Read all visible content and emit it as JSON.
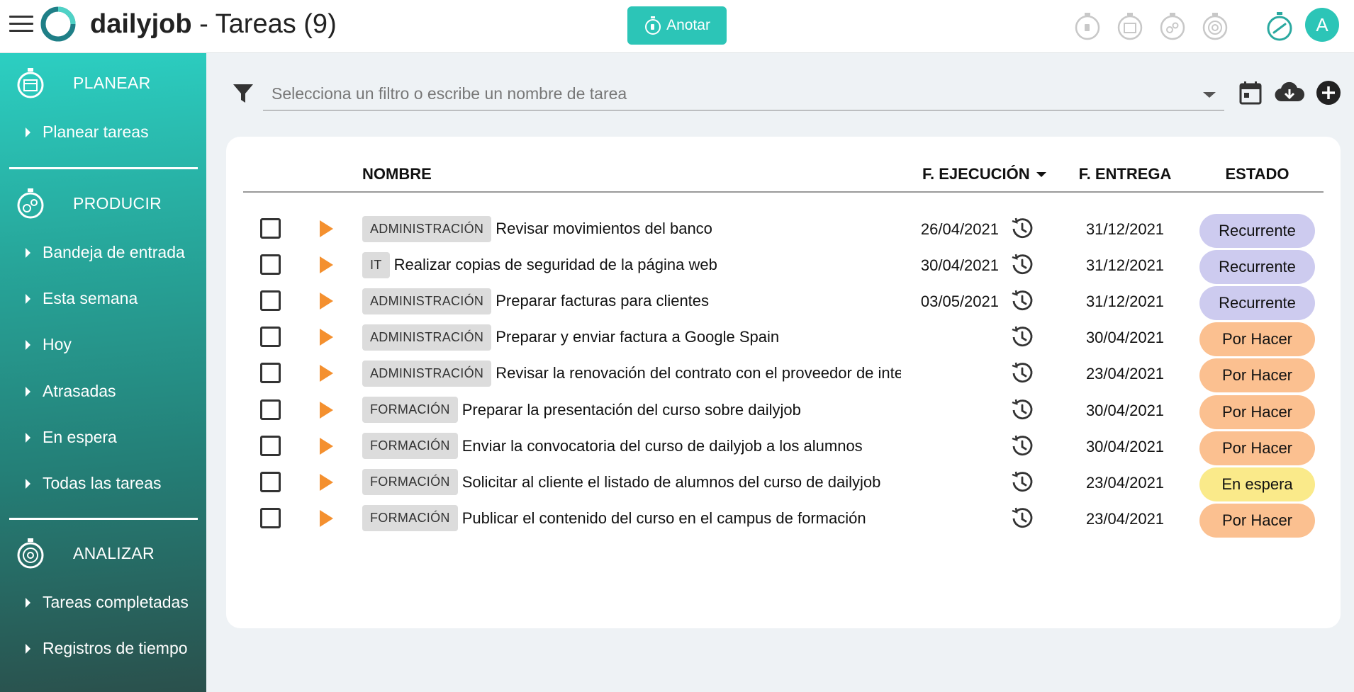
{
  "header": {
    "brand": "dailyjob",
    "page_title": " - Tareas (9)",
    "anotar_label": "Anotar",
    "avatar_initial": "A",
    "accent_color": "#2cc5b7"
  },
  "sidebar": {
    "sections": [
      {
        "label": "PLANEAR",
        "icon": "calendar-stopwatch-icon",
        "items": [
          "Planear tareas"
        ]
      },
      {
        "label": "PRODUCIR",
        "icon": "gears-stopwatch-icon",
        "items": [
          "Bandeja de entrada",
          "Esta semana",
          "Hoy",
          "Atrasadas",
          "En espera",
          "Todas las tareas"
        ]
      },
      {
        "label": "ANALIZAR",
        "icon": "target-stopwatch-icon",
        "items": [
          "Tareas completadas",
          "Registros de tiempo"
        ]
      }
    ]
  },
  "filter": {
    "placeholder": "Selecciona un filtro o escribe un nombre de tarea"
  },
  "table": {
    "columns": {
      "nombre": "NOMBRE",
      "f_ejecucion": "F. EJECUCIÓN",
      "f_entrega": "F. ENTREGA",
      "estado": "ESTADO"
    },
    "rows": [
      {
        "tag": "ADMINISTRACIÓN",
        "name": "Revisar movimientos del banco",
        "f_ejecucion": "26/04/2021",
        "f_entrega": "31/12/2021",
        "estado": "Recurrente"
      },
      {
        "tag": "IT",
        "name": "Realizar copias de seguridad de la página web",
        "f_ejecucion": "30/04/2021",
        "f_entrega": "31/12/2021",
        "estado": "Recurrente"
      },
      {
        "tag": "ADMINISTRACIÓN",
        "name": "Preparar facturas para clientes",
        "f_ejecucion": "03/05/2021",
        "f_entrega": "31/12/2021",
        "estado": "Recurrente"
      },
      {
        "tag": "ADMINISTRACIÓN",
        "name": "Preparar y enviar factura a Google Spain",
        "f_ejecucion": "",
        "f_entrega": "30/04/2021",
        "estado": "Por Hacer"
      },
      {
        "tag": "ADMINISTRACIÓN",
        "name": "Revisar la renovación del contrato con el proveedor de internet",
        "f_ejecucion": "",
        "f_entrega": "23/04/2021",
        "estado": "Por Hacer"
      },
      {
        "tag": "FORMACIÓN",
        "name": "Preparar la presentación del curso sobre dailyjob",
        "f_ejecucion": "",
        "f_entrega": "30/04/2021",
        "estado": "Por Hacer"
      },
      {
        "tag": "FORMACIÓN",
        "name": "Enviar la convocatoria del curso de dailyjob a los alumnos",
        "f_ejecucion": "",
        "f_entrega": "30/04/2021",
        "estado": "Por Hacer"
      },
      {
        "tag": "FORMACIÓN",
        "name": "Solicitar al cliente el listado de alumnos del curso de dailyjob",
        "f_ejecucion": "",
        "f_entrega": "23/04/2021",
        "estado": "En espera"
      },
      {
        "tag": "FORMACIÓN",
        "name": "Publicar el contenido del curso en el campus de formación",
        "f_ejecucion": "",
        "f_entrega": "23/04/2021",
        "estado": "Por Hacer"
      }
    ]
  },
  "status_colors": {
    "Recurrente": "#cdcbef",
    "Por Hacer": "#fbc090",
    "En espera": "#faea8a"
  }
}
